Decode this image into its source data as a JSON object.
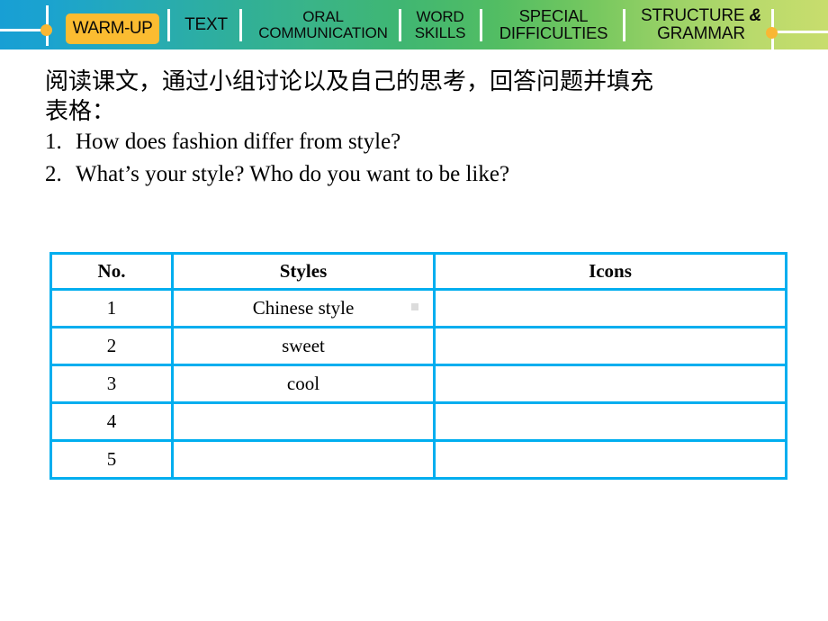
{
  "nav": {
    "tabs": [
      {
        "id": "warm-up",
        "lines": [
          "WARM-UP"
        ],
        "active": true
      },
      {
        "id": "text",
        "lines": [
          "TEXT"
        ],
        "active": false
      },
      {
        "id": "oral",
        "lines": [
          "ORAL",
          "COMMUNICATION"
        ],
        "active": false
      },
      {
        "id": "word",
        "lines": [
          "WORD",
          "SKILLS"
        ],
        "active": false
      },
      {
        "id": "special",
        "lines": [
          "SPECIAL",
          "DIFFICULTIES"
        ],
        "active": false
      },
      {
        "id": "structure",
        "lines": [
          "STRUCTURE",
          "GRAMMAR"
        ],
        "active": false
      }
    ],
    "labels": {
      "warm_up": "WARM-UP",
      "text": "TEXT",
      "oral_line1": "ORAL",
      "oral_line2": "COMMUNICATION",
      "word_line1": "WORD",
      "word_line2": "SKILLS",
      "special_line1": "SPECIAL",
      "special_line2": "DIFFICULTIES",
      "structure_line1": "STRUCTURE",
      "structure_amp": "&",
      "structure_line2": "GRAMMAR"
    },
    "colors": {
      "gradient_start": "#189fd4",
      "gradient_mid": "#3ab487",
      "gradient_end": "#c8dd6d",
      "active_tab_bg": "#fbbc31",
      "separator": "#ffffff",
      "dot": "#f9b733"
    }
  },
  "prompt": {
    "instruction_line1": "阅读课文，通过小组讨论以及自己的思考，回答问题并填充",
    "instruction_line2": "表格：",
    "questions": [
      {
        "num": "1.",
        "text": "How does fashion differ from style?"
      },
      {
        "num": "2.",
        "text": "What’s your style? Who do you want to be like?"
      }
    ]
  },
  "table": {
    "border_color": "#00aeef",
    "headers": [
      "No.",
      "Styles",
      "Icons"
    ],
    "rows": [
      {
        "no": "1",
        "style": "Chinese style",
        "icon": ""
      },
      {
        "no": "2",
        "style": "sweet",
        "icon": ""
      },
      {
        "no": "3",
        "style": "cool",
        "icon": ""
      },
      {
        "no": "4",
        "style": "",
        "icon": ""
      },
      {
        "no": "5",
        "style": "",
        "icon": ""
      }
    ]
  }
}
